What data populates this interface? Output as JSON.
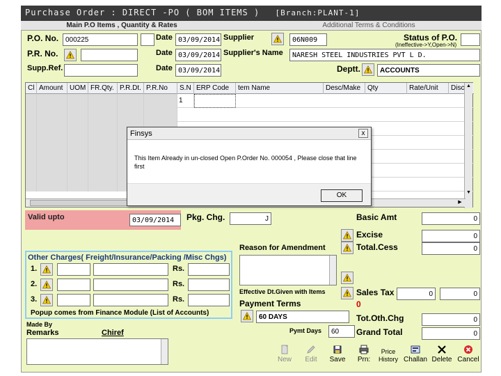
{
  "window": {
    "title": "Purchase Order : DIRECT -PO ( BOM ITEMS )",
    "branch": "[Branch:PLANT-1]"
  },
  "tabs": [
    "Main P.O Items , Quantity & Rates",
    "Additional Terms & Conditions"
  ],
  "header": {
    "po_no_label": "P.O. No.",
    "po_no_value": "000225",
    "pr_no_label": "P.R. No.",
    "supp_ref_label": "Supp.Ref.",
    "date_label": "Date",
    "date1": "03/09/2014",
    "date2": "03/09/2014",
    "date3": "03/09/2014",
    "supplier_label": "Supplier",
    "supplier_code": "06N009",
    "supplier_name_label": "Supplier's Name",
    "supplier_name": "NARESH STEEL INDUSTRIES PVT L D.",
    "status_label": "Status of P.O.",
    "status_hint": "(Ineffective->Y,Open->N)",
    "deptt_label": "Deptt.",
    "deptt_value": "ACCOUNTS"
  },
  "grid": {
    "columns": [
      "Cl",
      "Amount",
      "UOM",
      "FR.Qty.",
      "P.R.Dt.",
      "P.R.No",
      "S.N",
      "ERP Code",
      "tem Name",
      "Desc/Make",
      "Qty",
      "Rate/Unit",
      "Disc %"
    ],
    "first_row_sn": "1"
  },
  "dialog": {
    "title": "Finsys",
    "close": "x",
    "message": "This Item Already in un-closed Open P.Order No. 000054 , Please close that line first",
    "ok": "OK"
  },
  "lower": {
    "valid_upto_label": "Valid upto",
    "valid_upto_value": "03/09/2014",
    "pkg_chg_label": "Pkg. Chg.",
    "pkg_chg_value": "J",
    "reason_label": "Reason for Amendment",
    "other_charges_title": "Other Charges( Freight/Insurance/Packing /Misc Chgs)",
    "rows": [
      "1.",
      "2.",
      "3."
    ],
    "rs_label": "Rs.",
    "popup_note": "Popup comes from Finance Module (List of Accounts)",
    "effective_label": "Effective Dt.Given with Items",
    "payment_terms_label": "Payment Terms",
    "payment_terms_value": "60 DAYS",
    "zero_red": "0",
    "pymt_days_label": "Pymt Days",
    "pymt_days_value": "60",
    "made_by_label": "Made By",
    "remarks_label": "Remarks",
    "made_by_value": "Chiref"
  },
  "totals": {
    "basic_label": "Basic Amt",
    "basic_value": "0",
    "excise_label": "Excise",
    "excise_value": "0",
    "tot_cess_label": "Total.Cess",
    "tot_cess_value": "0",
    "sales_tax_label": "Sales Tax",
    "sales_tax_pct": "0",
    "sales_tax_value": "0",
    "oth_chg_label": "Tot.Oth.Chg",
    "oth_chg_value": "0",
    "grand_label": "Grand Total",
    "grand_value": "0"
  },
  "toolbar": {
    "new": "New",
    "edit": "Edit",
    "save": "Save",
    "print": "Prn:",
    "price_history": "Price History",
    "challan": "Challan",
    "delete": "Delete",
    "cancel": "Cancel"
  },
  "colors": {
    "form_bg": "#eef7c4",
    "valid_bar": "#f1a2a2",
    "accent_blue": "#8ecdf5",
    "title_bar": "#3a3a3a"
  }
}
